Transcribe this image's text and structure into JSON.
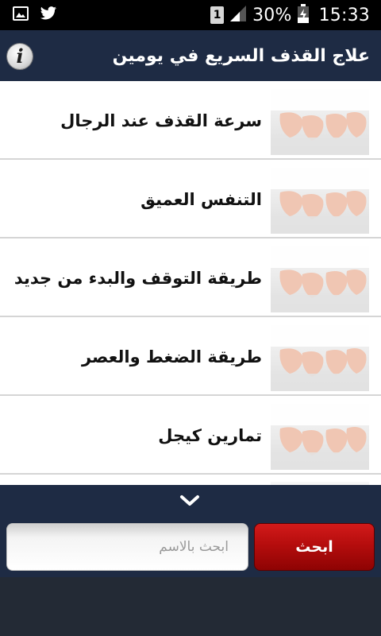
{
  "status_bar": {
    "sim": "1",
    "battery_percent": "30%",
    "time": "15:33",
    "icons": [
      "image-icon",
      "twitter-icon",
      "sim-icon",
      "signal-icon",
      "battery-icon"
    ]
  },
  "app_bar": {
    "title": "علاج القذف السريع في يومين",
    "info_icon": "info-icon"
  },
  "list": {
    "items": [
      {
        "label": "سرعة القذف عند الرجال"
      },
      {
        "label": "التنفس العميق"
      },
      {
        "label": "طريقة التوقف والبدء من جديد"
      },
      {
        "label": "طريقة الضغط والعصر"
      },
      {
        "label": "تمارين كيجل"
      },
      {
        "label": ""
      }
    ]
  },
  "search": {
    "placeholder": "ابحث بالاسم",
    "value": "",
    "button_label": "ابحث",
    "expand_icon": "chevron-down-icon"
  },
  "colors": {
    "app_bar": "#1e2b44",
    "search_button": "#b50d0d",
    "footer": "#232a35"
  }
}
